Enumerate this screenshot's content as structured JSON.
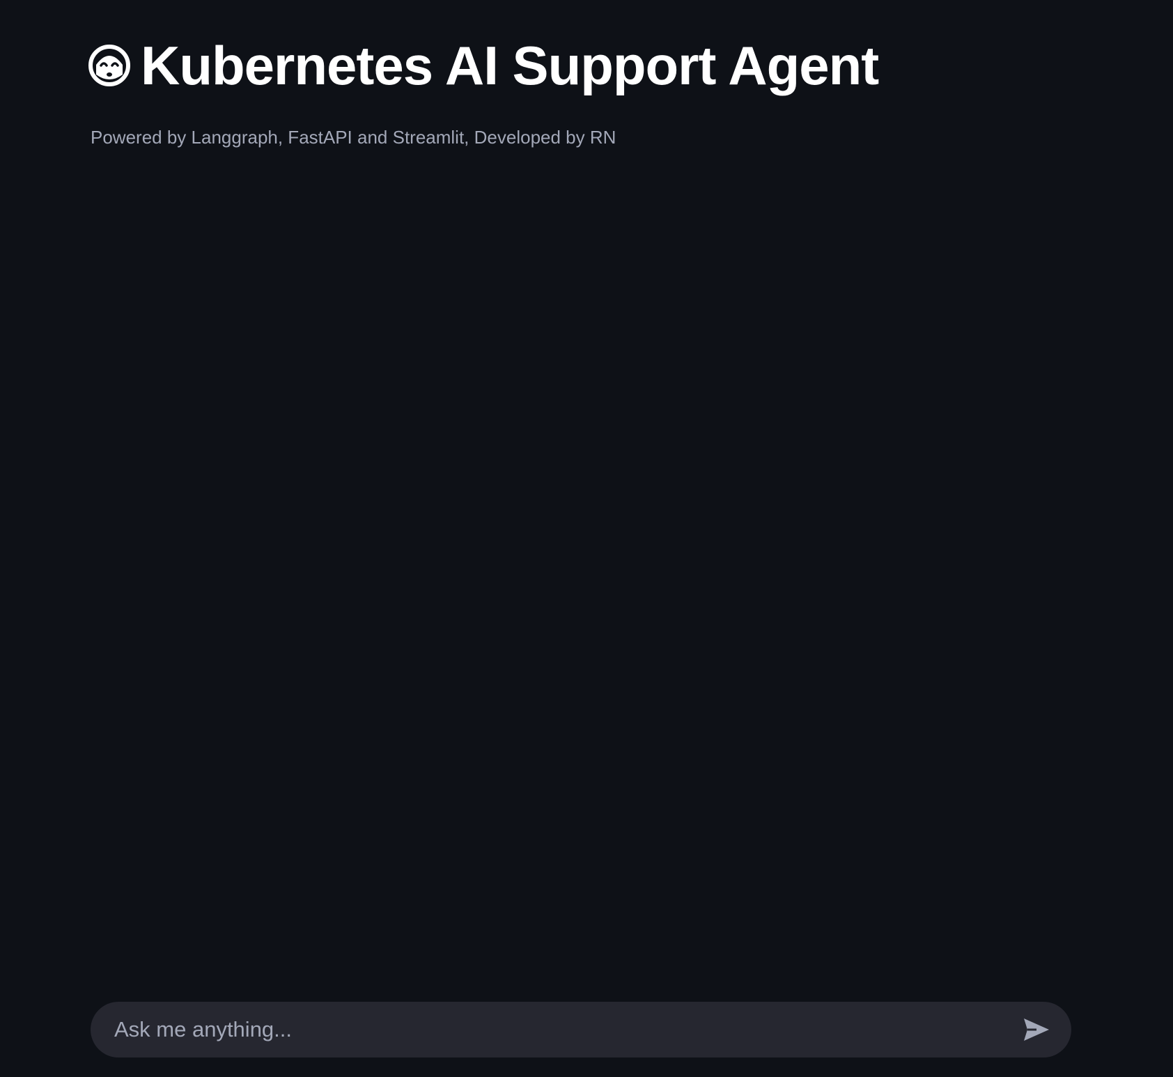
{
  "header": {
    "icon": "robot-face-icon",
    "title": "Kubernetes AI Support Agent",
    "caption": "Powered by Langgraph, FastAPI and Streamlit, Developed by RN"
  },
  "chat_input": {
    "placeholder": "Ask me anything...",
    "value": "",
    "send_icon": "send-arrow-icon"
  },
  "colors": {
    "background": "#0e1117",
    "input_background": "#262730",
    "caption_text": "#a3a8b8"
  }
}
